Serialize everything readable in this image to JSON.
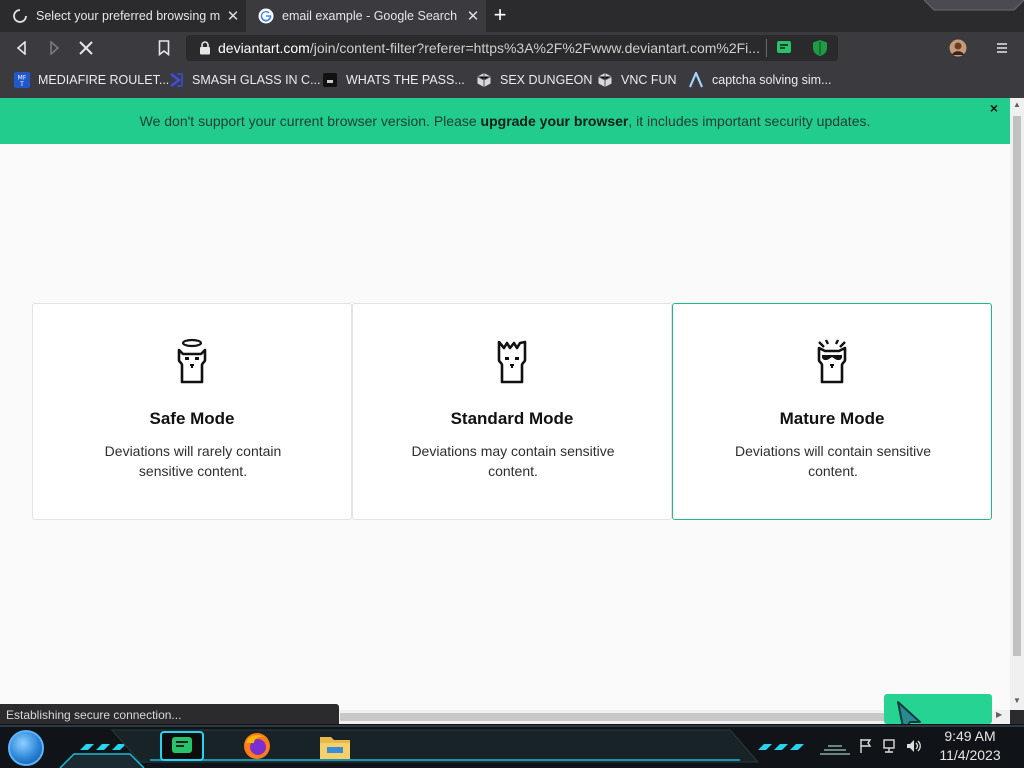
{
  "browser": {
    "tabs": [
      {
        "title": "Select your preferred browsing mo",
        "active": false,
        "icon": "loading-spinner-icon"
      },
      {
        "title": "email example - Google Search",
        "active": true,
        "icon": "google-icon"
      }
    ],
    "url_host": "deviantart.com",
    "url_path": "/join/content-filter?referer=https%3A%2F%2Fwww.deviantart.com%2Fi...",
    "bookmarks": [
      {
        "label": "MEDIAFIRE ROULET...",
        "icon": "mediafire-icon"
      },
      {
        "label": "SMASH GLASS IN C...",
        "icon": "bracket-icon"
      },
      {
        "label": "WHATS THE PASS...",
        "icon": "terminal-icon"
      },
      {
        "label": "SEX DUNGEON",
        "icon": "cube-icon"
      },
      {
        "label": "VNC FUN",
        "icon": "cube-icon"
      },
      {
        "label": "captcha solving sim...",
        "icon": "triangle-a-icon"
      }
    ]
  },
  "page": {
    "banner_text_before": "We don't support your current browser version. Please ",
    "banner_link": "upgrade your browser",
    "banner_text_after": ", it includes important security updates.",
    "banner_close": "×",
    "cards": [
      {
        "name": "Safe Mode",
        "desc": "Deviations will rarely contain sensitive content.",
        "selected": false,
        "icon": "safe-mascot-icon"
      },
      {
        "name": "Standard Mode",
        "desc": "Deviations may contain sensitive content.",
        "selected": false,
        "icon": "standard-mascot-icon"
      },
      {
        "name": "Mature Mode",
        "desc": "Deviations will contain sensitive content.",
        "selected": true,
        "icon": "mature-mascot-icon"
      }
    ]
  },
  "status_text": "Establishing secure connection...",
  "taskbar": {
    "time": "9:49 AM",
    "date": "11/4/2023"
  },
  "colors": {
    "banner_bg": "#22cc8d",
    "selected_border": "#1fb886",
    "browser_chrome": "#3b3b3f"
  }
}
